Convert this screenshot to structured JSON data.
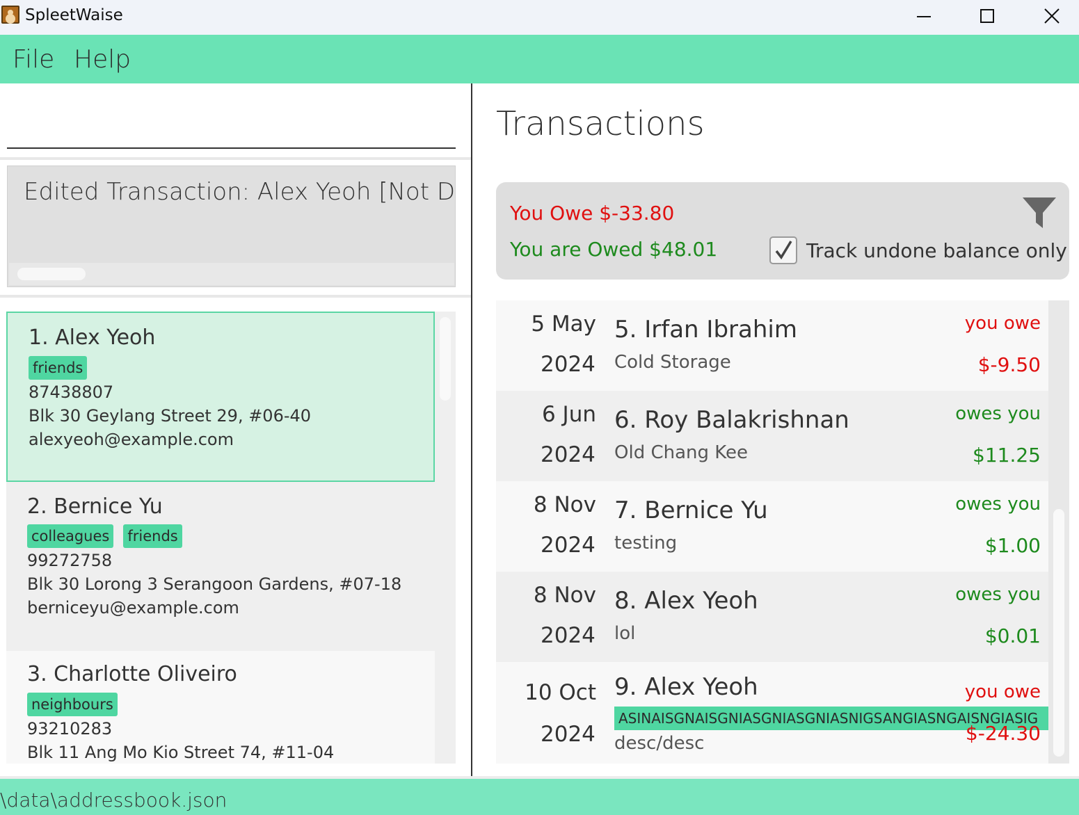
{
  "window": {
    "title": "SpleetWaise"
  },
  "menu": {
    "file": "File",
    "help": "Help"
  },
  "command": {
    "value": ""
  },
  "result": {
    "text": "Edited Transaction: Alex Yeoh [Not Done] ("
  },
  "persons": [
    {
      "index_name": "1. Alex Yeoh",
      "tags": [
        "friends"
      ],
      "phone": "87438807",
      "address": "Blk 30 Geylang Street 29, #06-40",
      "email": "alexyeoh@example.com"
    },
    {
      "index_name": "2. Bernice Yu",
      "tags": [
        "colleagues",
        "friends"
      ],
      "phone": "99272758",
      "address": "Blk 30 Lorong 3 Serangoon Gardens, #07-18",
      "email": "berniceyu@example.com"
    },
    {
      "index_name": "3. Charlotte Oliveiro",
      "tags": [
        "neighbours"
      ],
      "phone": "93210283",
      "address": "Blk 11 Ang Mo Kio Street 74, #11-04",
      "email": ""
    }
  ],
  "transactions_panel": {
    "title": "Transactions",
    "you_owe": "You Owe $-33.80",
    "you_are_owed": "You are Owed $48.01",
    "track_label": "Track undone balance only",
    "track_checked": true,
    "owe_color": "#e01010",
    "owed_color": "#1d8a1d"
  },
  "transactions": [
    {
      "day": "5 May",
      "year": "2024",
      "name": "5. Irfan Ibrahim",
      "desc": "Cold Storage",
      "status": "you owe",
      "amount": "$-9.50",
      "kind": "neg"
    },
    {
      "day": "6 Jun",
      "year": "2024",
      "name": "6. Roy Balakrishnan",
      "desc": "Old Chang Kee",
      "status": "owes you",
      "amount": "$11.25",
      "kind": "pos"
    },
    {
      "day": "8 Nov",
      "year": "2024",
      "name": "7. Bernice Yu",
      "desc": "testing",
      "status": "owes you",
      "amount": "$1.00",
      "kind": "pos"
    },
    {
      "day": "8 Nov",
      "year": "2024",
      "name": "8. Alex Yeoh",
      "desc": "lol",
      "status": "owes you",
      "amount": "$0.01",
      "kind": "pos"
    },
    {
      "day": "10 Oct",
      "year": "2024",
      "name": "9. Alex Yeoh",
      "category": "ASINAISGNAISGNIASGNIASGNIASNIGSANGIASNGAISNGIASIG",
      "desc": "desc/desc",
      "status": "you owe",
      "amount": "$-24.30",
      "kind": "neg"
    }
  ],
  "icons": {
    "app": "addressbook-icon",
    "minimize": "minimize-icon",
    "maximize": "maximize-icon",
    "close": "close-icon",
    "filter": "filter-icon",
    "checkbox": "checkmark-icon"
  },
  "status": {
    "path": "\\data\\addressbook.json"
  }
}
